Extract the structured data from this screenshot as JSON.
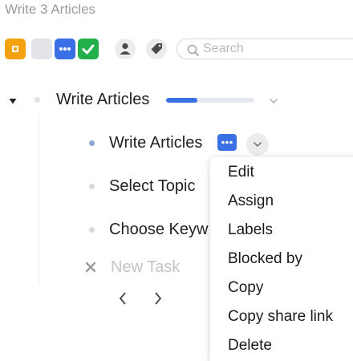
{
  "header": {
    "title": "Write 3 Articles"
  },
  "toolbar": {
    "buttons": [
      {
        "name": "square-icon",
        "color": "#f4a10f"
      },
      {
        "name": "blank",
        "color": "#e2e4e9"
      },
      {
        "name": "ellipsis-icon",
        "color": "#3b6fe6"
      },
      {
        "name": "checkmark-icon",
        "color": "#23b04b"
      },
      {
        "name": "person-icon",
        "color": "#ececec"
      },
      {
        "name": "tag-icon",
        "color": "#ececec"
      }
    ],
    "search_placeholder": "Search"
  },
  "tree": {
    "parent": {
      "label": "Write Articles",
      "progress": 0.35
    },
    "children": [
      {
        "label": "Write Articles",
        "dot_color": "#8ea5d6"
      },
      {
        "label": "Select Topic",
        "dot_color": "#d9d9d9"
      },
      {
        "label": "Choose Keyw",
        "dot_color": "#d9d9d9"
      }
    ],
    "new_task_label": "New Task"
  },
  "context_menu": {
    "items": [
      "Edit",
      "Assign",
      "Labels",
      "Blocked by",
      "Copy",
      "Copy share link",
      "Delete"
    ]
  },
  "colors": {
    "accent": "#3b6fe6",
    "muted_text": "#9b9b9b"
  }
}
